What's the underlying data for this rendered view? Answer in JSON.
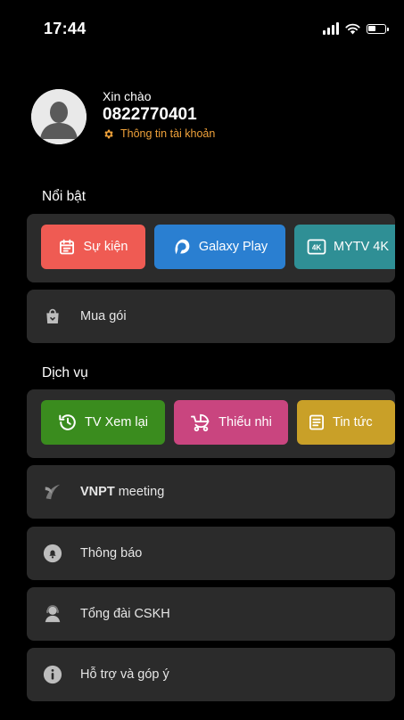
{
  "status": {
    "time": "17:44"
  },
  "profile": {
    "greeting": "Xin chào",
    "phone": "0822770401",
    "account_link": "Thông tin tài khoản"
  },
  "featured": {
    "title": "Nổi bật",
    "pills": [
      {
        "label": "Sự kiện",
        "icon": "calendar-icon",
        "color": "#ef5b53"
      },
      {
        "label": "Galaxy Play",
        "icon": "galaxy-play-logo-icon",
        "color": "#2a7fd1"
      },
      {
        "label": "MYTV 4K",
        "icon": "4k-icon",
        "color": "#2f8f95"
      }
    ],
    "buy": {
      "label": "Mua gói",
      "icon": "shopping-bag-icon"
    }
  },
  "services": {
    "title": "Dịch vụ",
    "pills": [
      {
        "label": "TV Xem lại",
        "icon": "history-clock-icon",
        "color": "#3a8c1e"
      },
      {
        "label": "Thiếu nhi",
        "icon": "baby-stroller-icon",
        "color": "#c9457f"
      },
      {
        "label": "Tin tức",
        "icon": "newspaper-icon",
        "color": "#c9a028"
      }
    ]
  },
  "menu": [
    {
      "label_bold": "VNPT",
      "label": " meeting",
      "icon": "vnpt-logo-icon"
    },
    {
      "label": "Thông báo",
      "icon": "bell-icon"
    },
    {
      "label": "Tổng đài CSKH",
      "icon": "customer-support-icon"
    },
    {
      "label": "Hỗ trợ và góp ý",
      "icon": "info-icon"
    }
  ],
  "colors": {
    "background": "#000000",
    "card": "#2b2b2b",
    "accent": "#f0a23a"
  }
}
